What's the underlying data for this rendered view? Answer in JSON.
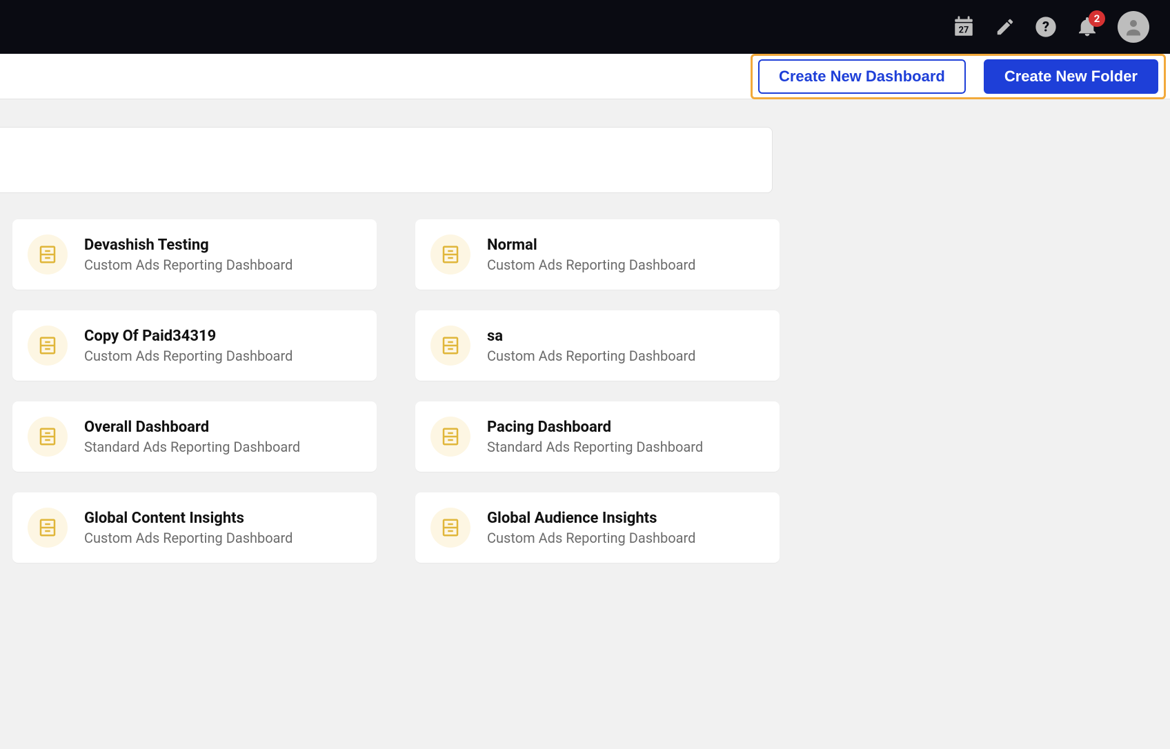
{
  "topbar": {
    "calendar_day": "27",
    "notification_count": "2"
  },
  "actions": {
    "create_dashboard": "Create New Dashboard",
    "create_folder": "Create New Folder"
  },
  "cards": [
    {
      "title": "Devashish Testing",
      "subtitle": "Custom Ads Reporting Dashboard"
    },
    {
      "title": "Normal",
      "subtitle": "Custom Ads Reporting Dashboard"
    },
    {
      "title": "Copy Of Paid34319",
      "subtitle": "Custom Ads Reporting Dashboard"
    },
    {
      "title": "sa",
      "subtitle": "Custom Ads Reporting Dashboard"
    },
    {
      "title": "Overall Dashboard",
      "subtitle": "Standard Ads Reporting Dashboard"
    },
    {
      "title": "Pacing Dashboard",
      "subtitle": "Standard Ads Reporting Dashboard"
    },
    {
      "title": "Global Content Insights",
      "subtitle": "Custom Ads Reporting Dashboard"
    },
    {
      "title": "Global Audience Insights",
      "subtitle": "Custom Ads Reporting Dashboard"
    }
  ]
}
